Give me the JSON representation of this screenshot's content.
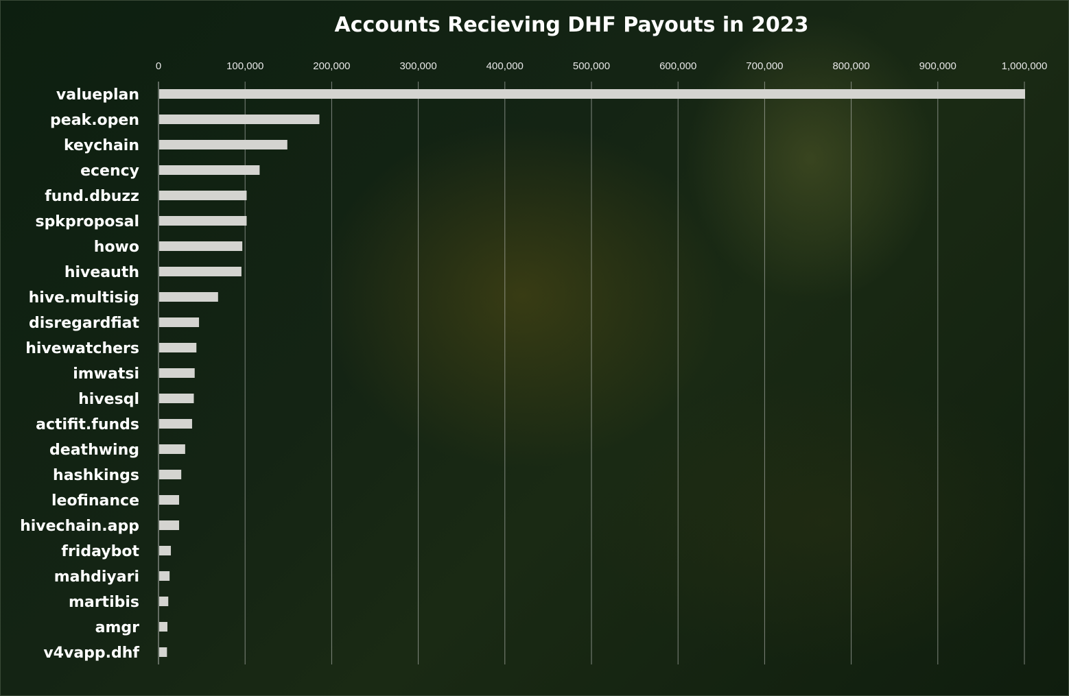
{
  "chart_data": {
    "type": "bar",
    "orientation": "horizontal",
    "title": "Accounts Recieving DHF Payouts in 2023",
    "xlabel": "",
    "ylabel": "",
    "xlim": [
      0,
      1000000
    ],
    "x_ticks": [
      0,
      100000,
      200000,
      300000,
      400000,
      500000,
      600000,
      700000,
      800000,
      900000,
      1000000
    ],
    "x_tick_labels": [
      "0",
      "100,000",
      "200,000",
      "300,000",
      "400,000",
      "500,000",
      "600,000",
      "700,000",
      "800,000",
      "900,000",
      "1,000,000"
    ],
    "x_axis_position": "top",
    "grid": "vertical",
    "legend": "none",
    "bar_color": "#d4d4d0",
    "categories": [
      "valueplan",
      "peak.open",
      "keychain",
      "ecency",
      "fund.dbuzz",
      "spkproposal",
      "howo",
      "hiveauth",
      "hive.multisig",
      "disregardfiat",
      "hivewatchers",
      "imwatsi",
      "hivesql",
      "actifit.funds",
      "deathwing",
      "hashkings",
      "leofinance",
      "hivechain.app",
      "fridaybot",
      "mahdiyari",
      "martibis",
      "amgr",
      "v4vapp.dhf"
    ],
    "values": [
      1000000,
      185000,
      148000,
      116000,
      101000,
      101000,
      96000,
      95000,
      68000,
      46000,
      43000,
      41000,
      40000,
      38000,
      30000,
      25500,
      23000,
      23000,
      13500,
      12000,
      10500,
      9500,
      9000
    ]
  }
}
